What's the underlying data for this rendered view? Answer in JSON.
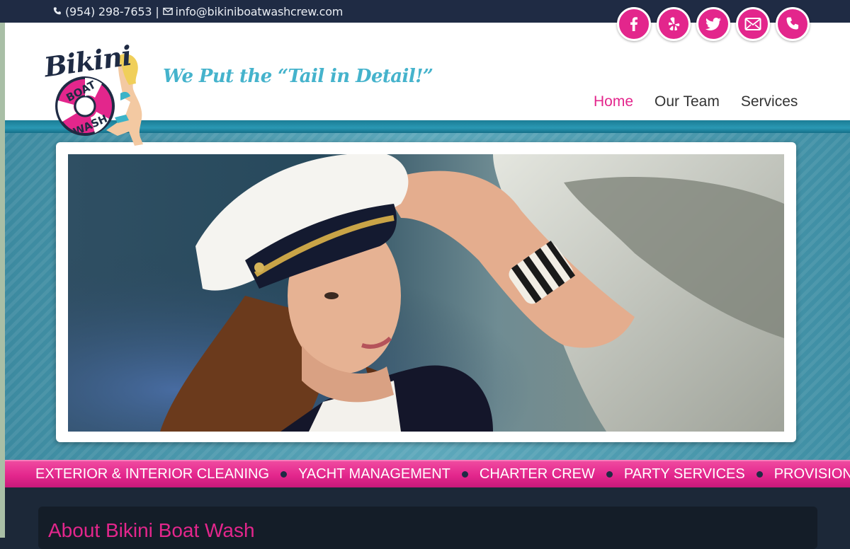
{
  "topbar": {
    "phone": "(954) 298-7653",
    "separator": "|",
    "email": "info@bikiniboatwashcrew.com"
  },
  "logo": {
    "word1": "Bikini",
    "word2": "BOAT",
    "word3": "WASH"
  },
  "tagline": "We Put the “Tail in Detail!”",
  "nav": {
    "items": [
      {
        "label": "Home",
        "active": true
      },
      {
        "label": "Our Team",
        "active": false
      },
      {
        "label": "Services",
        "active": false
      }
    ]
  },
  "social": [
    "facebook-icon",
    "yelp-icon",
    "twitter-icon",
    "email-icon",
    "phone-icon"
  ],
  "services": [
    "EXTERIOR & INTERIOR CLEANING",
    "YACHT MANAGEMENT",
    "CHARTER CREW",
    "PARTY SERVICES",
    "PROVISIONING"
  ],
  "about": {
    "title": "About Bikini Boat Wash"
  },
  "colors": {
    "accent": "#e3268c",
    "navy": "#1f2b44",
    "teal": "#45b3cc"
  }
}
